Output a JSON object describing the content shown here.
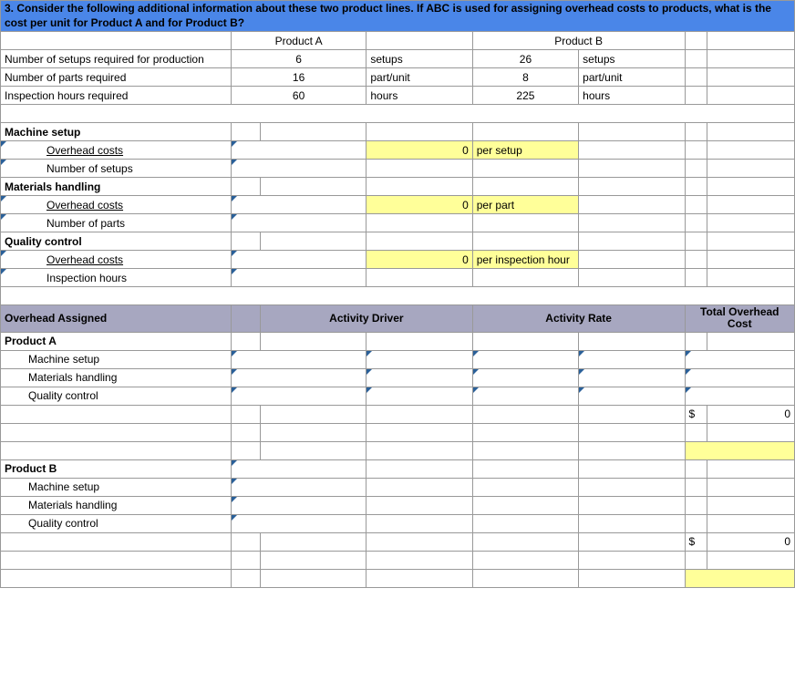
{
  "question": "3.  Consider the following additional information about these two product lines. If ABC is used for assigning overhead costs to products, what is the cost per unit for Product A and for Product B?",
  "products": {
    "a": "Product A",
    "b": "Product B"
  },
  "rows": {
    "setups": {
      "label": "Number of setups required for production",
      "a": "6",
      "ua": "setups",
      "b": "26",
      "ub": "setups"
    },
    "parts": {
      "label": "Number of parts required",
      "a": "16",
      "ua": "part/unit",
      "b": "8",
      "ub": "part/unit"
    },
    "insp": {
      "label": "Inspection hours required",
      "a": "60",
      "ua": "hours",
      "b": "225",
      "ub": "hours"
    }
  },
  "sections": {
    "ms": {
      "title": "Machine setup",
      "l1": "Overhead costs",
      "l2": "Number of setups",
      "rate": "0",
      "unit": "per setup"
    },
    "mh": {
      "title": "Materials handling",
      "l1": "Overhead costs",
      "l2": "Number of parts",
      "rate": "0",
      "unit": "per part"
    },
    "qc": {
      "title": "Quality control",
      "l1": "Overhead costs",
      "l2": "Inspection hours",
      "rate": "0",
      "unit": "per inspection hour"
    }
  },
  "assigned": {
    "header": {
      "c0": "Overhead Assigned",
      "c1": "Activity Driver",
      "c2": "Activity Rate",
      "c3": "Total Overhead Cost"
    },
    "a": {
      "title": "Product A",
      "r1": "Machine setup",
      "r2": "Materials handling",
      "r3": "Quality control",
      "total_sym": "$",
      "total_val": "0"
    },
    "b": {
      "title": "Product B",
      "r1": "Machine setup",
      "r2": "Materials handling",
      "r3": "Quality control",
      "total_sym": "$",
      "total_val": "0"
    }
  }
}
